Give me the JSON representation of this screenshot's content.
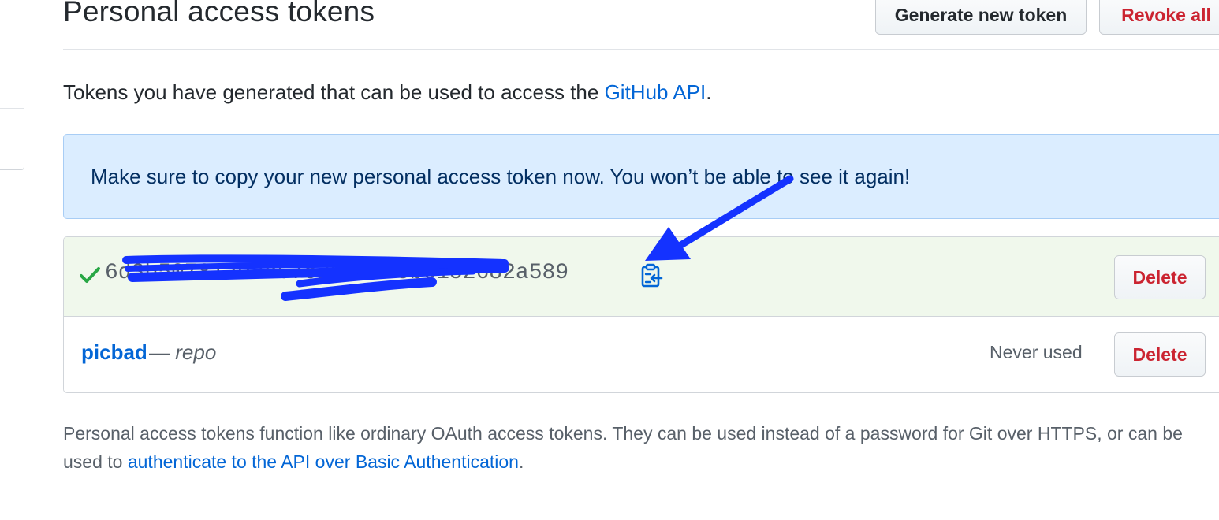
{
  "header": {
    "title": "Personal access tokens",
    "generate_button": "Generate new token",
    "revoke_all_button": "Revoke all"
  },
  "intro": {
    "text_before": "Tokens you have generated that can be used to access the ",
    "link_text": "GitHub API",
    "text_after": "."
  },
  "flash": {
    "message": "Make sure to copy your new personal access token now. You won’t be able to see it again!"
  },
  "tokens": [
    {
      "value_visible_start": "6d",
      "value_visible_end": "65b6152682a589",
      "delete_label": "Delete",
      "icons": [
        "check-icon",
        "clipboard-icon"
      ]
    },
    {
      "name": "picbad",
      "separator": " — ",
      "scope": "repo",
      "last_used": "Never used",
      "delete_label": "Delete"
    }
  ],
  "footer": {
    "text": "Personal access tokens function like ordinary OAuth access tokens. They can be used instead of a password for Git over HTTPS, or can be used to ",
    "link_text": "authenticate to the API over Basic Authentication",
    "text_after": "."
  },
  "colors": {
    "link": "#0366d6",
    "danger": "#cb2431",
    "flash_bg": "#dbedff",
    "new_token_bg": "#f0f8ec",
    "annotation_blue": "#1432ff"
  }
}
